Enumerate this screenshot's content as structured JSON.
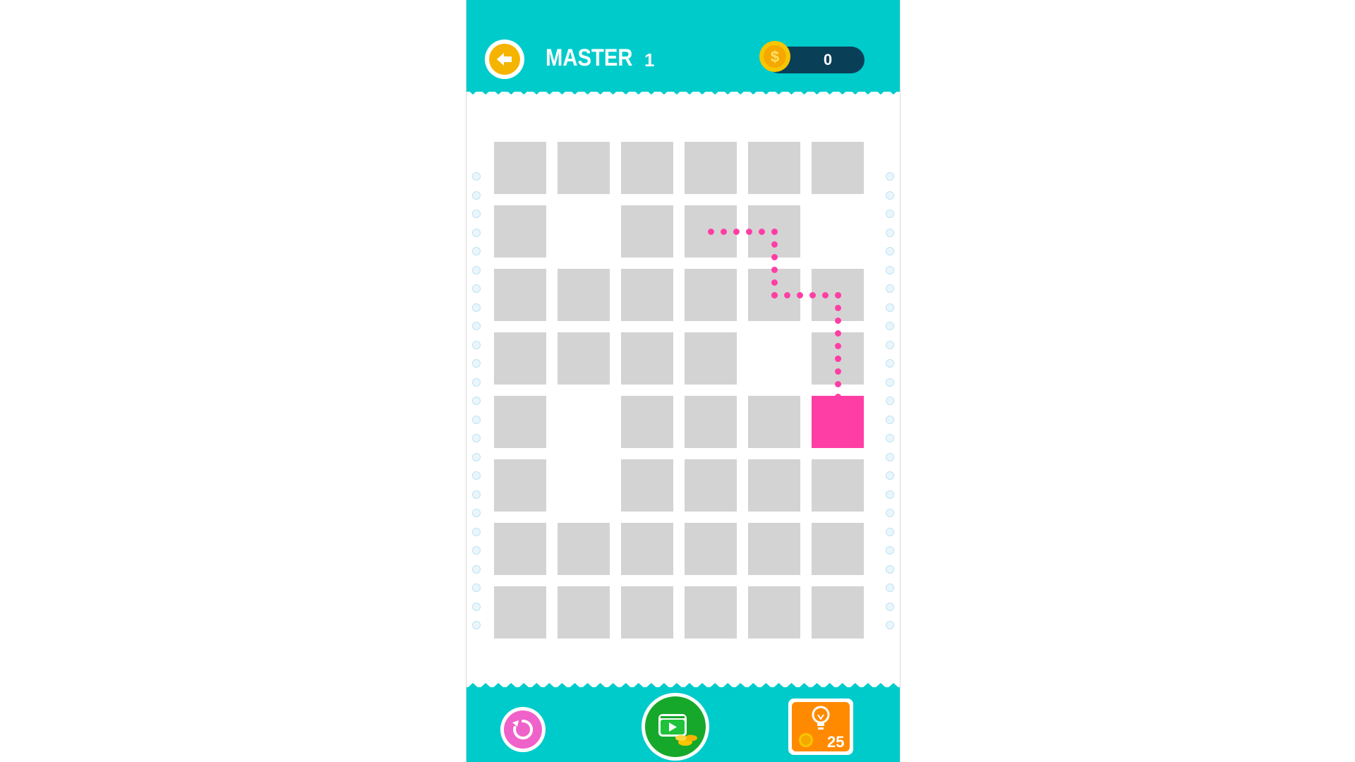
{
  "header": {
    "mode_label": "MASTER",
    "level": "1",
    "coins": "0"
  },
  "board": {
    "columns": 6,
    "rows": 8,
    "layout": [
      [
        "block",
        "block",
        "block",
        "block",
        "block",
        "block"
      ],
      [
        "block",
        "empty",
        "block",
        "block",
        "block",
        "empty"
      ],
      [
        "block",
        "block",
        "block",
        "block",
        "block",
        "block"
      ],
      [
        "block",
        "block",
        "block",
        "block",
        "empty",
        "block"
      ],
      [
        "block",
        "empty",
        "block",
        "block",
        "block",
        "head"
      ],
      [
        "block",
        "empty",
        "block",
        "block",
        "block",
        "block"
      ],
      [
        "block",
        "block",
        "block",
        "block",
        "block",
        "block"
      ],
      [
        "block",
        "block",
        "block",
        "block",
        "block",
        "block"
      ]
    ],
    "hint_path_cells": [
      [
        1,
        3
      ],
      [
        1,
        4
      ],
      [
        2,
        4
      ],
      [
        2,
        5
      ],
      [
        3,
        5
      ],
      [
        4,
        5
      ]
    ]
  },
  "footer": {
    "hint_cost": "25"
  },
  "colors": {
    "brand_teal": "#00cbcb",
    "block_gray": "#d4d3d3",
    "path_pink": "#ff3ea5",
    "coin_gold": "#f5b400",
    "coin_bar": "#0a3f58",
    "restart_pink": "#ef62c9",
    "video_green": "#16a82a",
    "hint_orange": "#ff8a00"
  },
  "icons": {
    "back": "arrow-left-icon",
    "coin": "coin-icon",
    "restart": "restart-icon",
    "video": "video-reward-icon",
    "hint": "lightbulb-icon"
  }
}
